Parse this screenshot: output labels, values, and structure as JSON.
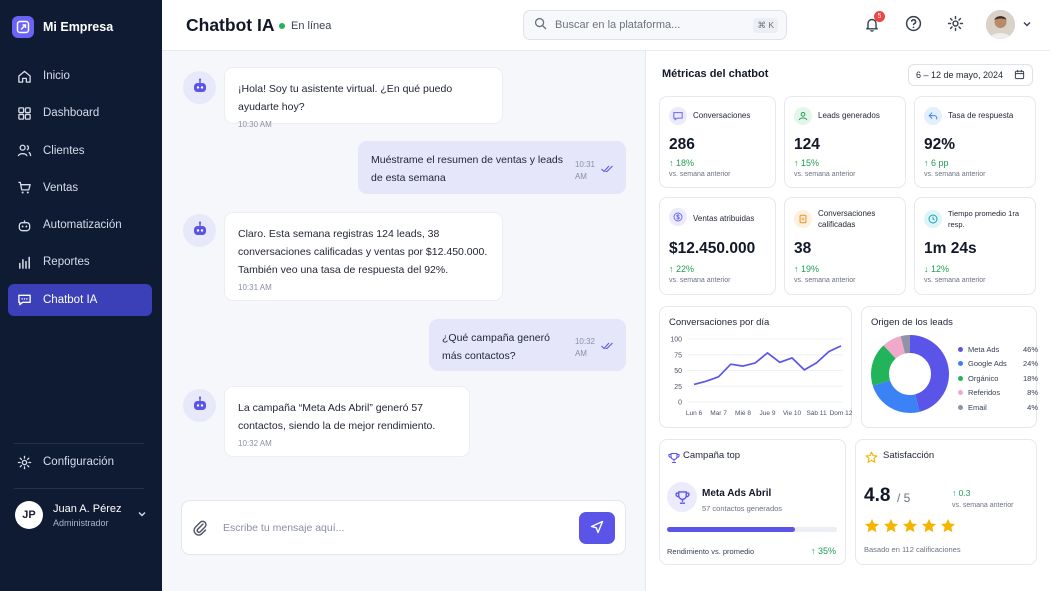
{
  "brand": {
    "name": "Mi Empresa"
  },
  "sidebar": {
    "items": [
      {
        "label": "Inicio",
        "icon": "home-icon"
      },
      {
        "label": "Dashboard",
        "icon": "grid-icon"
      },
      {
        "label": "Clientes",
        "icon": "users-icon"
      },
      {
        "label": "Ventas",
        "icon": "cart-icon"
      },
      {
        "label": "Automatización",
        "icon": "robot-icon"
      },
      {
        "label": "Reportes",
        "icon": "bar-chart-icon"
      },
      {
        "label": "Chatbot IA",
        "icon": "chat-icon",
        "active": true
      }
    ],
    "settings_label": "Configuración",
    "user": {
      "initials": "JP",
      "name": "Juan A. Pérez",
      "role": "Administrador"
    }
  },
  "header": {
    "title": "Chatbot IA",
    "status": "En línea",
    "search_placeholder": "Buscar en la plataforma...",
    "search_shortcut": "⌘ K",
    "notifications_count": "5"
  },
  "chat": {
    "messages": [
      {
        "from": "bot",
        "text": "¡Hola! Soy tu asistente virtual. ¿En qué puedo ayudarte hoy?",
        "time": "10:30 AM"
      },
      {
        "from": "user",
        "text": "Muéstrame el resumen de ventas y leads de esta semana",
        "time": "10:31 AM"
      },
      {
        "from": "bot",
        "text": "Claro. Esta semana registras 124 leads, 38 conversaciones calificadas y ventas por $12.450.000. También veo una tasa de respuesta del 92%.",
        "time": "10:31 AM"
      },
      {
        "from": "user",
        "text": "¿Qué campaña generó más contactos?",
        "time": "10:32 AM"
      },
      {
        "from": "bot",
        "text": "La campaña “Meta Ads Abril” generó 57 contactos, siendo la de mejor rendimiento.",
        "time": "10:32 AM"
      }
    ],
    "input_placeholder": "Escribe tu mensaje aquí..."
  },
  "metrics": {
    "title": "Métricas del chatbot",
    "date_range": "6 – 12 de mayo, 2024",
    "cards": [
      {
        "label": "Conversaciones",
        "value": "286",
        "change": "↑ 18%",
        "sub": "vs. semana anterior",
        "icon": "chat-bubble-icon",
        "color": "#6b63f6",
        "bg": "#ecebfd"
      },
      {
        "label": "Leads generados",
        "value": "124",
        "change": "↑ 15%",
        "sub": "vs. semana anterior",
        "icon": "users-icon",
        "color": "#22a05b",
        "bg": "#e3f6ea"
      },
      {
        "label": "Tasa de respuesta",
        "value": "92%",
        "change": "↑ 6 pp",
        "sub": "vs. semana anterior",
        "icon": "reply-icon",
        "color": "#3b82f6",
        "bg": "#e4effd"
      },
      {
        "label": "Ventas atribuidas",
        "value": "$12.450.000",
        "change": "↑ 22%",
        "sub": "vs. semana anterior",
        "icon": "dollar-icon",
        "color": "#6b63f6",
        "bg": "#ecebfd"
      },
      {
        "label": "Conversaciones calificadas",
        "value": "38",
        "change": "↑ 19%",
        "sub": "vs. semana anterior",
        "icon": "badge-icon",
        "color": "#e8902a",
        "bg": "#fdf0df"
      },
      {
        "label": "Tiempo promedio 1ra resp.",
        "value": "1m 24s",
        "change": "↓ 12%",
        "sub": "vs. semana anterior",
        "icon": "clock-icon",
        "color": "#14a3b8",
        "bg": "#def5f8"
      }
    ]
  },
  "chart_data": [
    {
      "type": "line",
      "title": "Conversaciones por día",
      "categories": [
        "Lun 6",
        "Mar 7",
        "Mié 8",
        "Jue 9",
        "Vie 10",
        "Sáb 11",
        "Dom 12"
      ],
      "x_positions": [
        0,
        0.5,
        1,
        1.5,
        2,
        2.5,
        3,
        3.5,
        4,
        4.5,
        5,
        5.5,
        6
      ],
      "values": [
        28,
        33,
        40,
        60,
        57,
        62,
        78,
        63,
        70,
        51,
        62,
        80,
        89
      ],
      "yticks": [
        0,
        25,
        50,
        75,
        100
      ],
      "ylim": [
        0,
        100
      ],
      "color": "#5a55e8"
    },
    {
      "type": "pie",
      "title": "Origen de los leads",
      "labels": [
        "Meta Ads",
        "Google Ads",
        "Orgánico",
        "Referidos",
        "Email"
      ],
      "values": [
        46,
        24,
        18,
        8,
        4
      ],
      "pct_labels": [
        "46%",
        "24%",
        "18%",
        "8%",
        "4%"
      ],
      "colors": [
        "#5a55e8",
        "#3b82f6",
        "#22b45a",
        "#f0a9c8",
        "#8f93a8"
      ]
    }
  ],
  "campaign": {
    "title": "Campaña top",
    "name": "Meta Ads Abril",
    "contacts": "57 contactos generados",
    "progress": 0.75,
    "footer_label": "Rendimiento vs. promedio",
    "footer_change": "↑ 35%"
  },
  "satisfaction": {
    "title": "Satisfacción",
    "score": "4.8",
    "max": "/ 5",
    "change": "↑ 0.3",
    "change_sub": "vs. semana anterior",
    "stars": 5,
    "footer": "Basado en 112 calificaciones"
  }
}
